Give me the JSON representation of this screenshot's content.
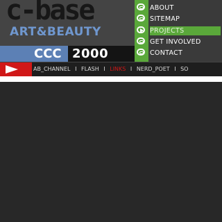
{
  "logo": {
    "main_text": "c-base",
    "subtitle": "ART&BEAUTY"
  },
  "ccc": {
    "label": "CCC",
    "year": "2000"
  },
  "nav": {
    "items": [
      {
        "label": "ABOUT"
      },
      {
        "label": "SITEMAP"
      },
      {
        "label": "PROJECTS",
        "active": true
      },
      {
        "label": "GET INVOLVED"
      },
      {
        "label": "CONTACT"
      }
    ]
  },
  "strip": {
    "links": [
      "AB_CHANNEL",
      "FLASH",
      "LINKS",
      "NERD_POET",
      "SO"
    ],
    "separator": "I"
  },
  "colors": {
    "nav_green": "#5aa83a",
    "logo_blue": "#6f97cf",
    "ccc_blue": "#5c80b5",
    "arrow_red": "#d01818"
  }
}
